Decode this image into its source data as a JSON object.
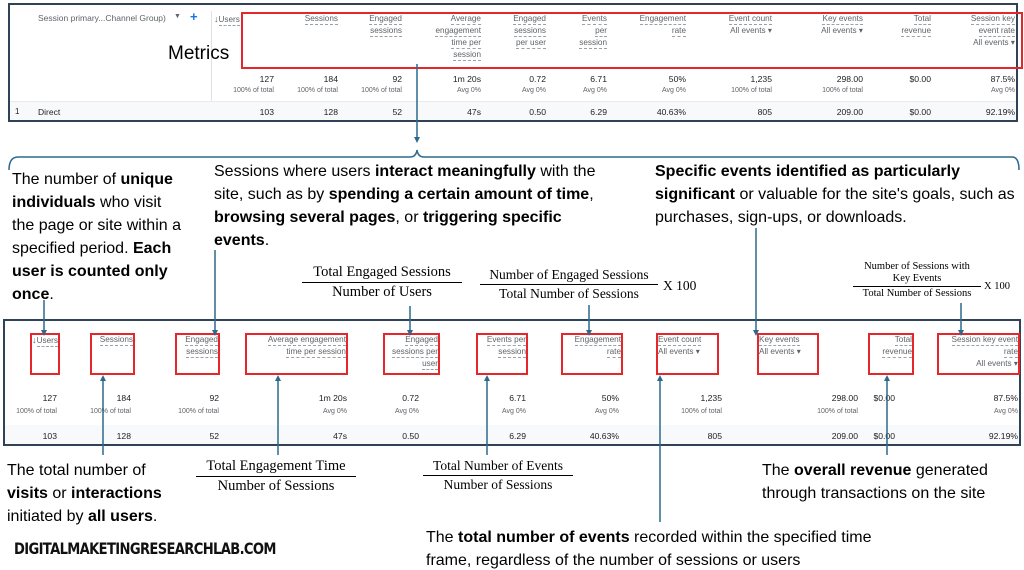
{
  "top_table": {
    "annotation_label": "Metrics",
    "dimension_header": "Session primary...Channel Group)",
    "dimension_caret_icon": "chevron-down-icon",
    "add_dimension_icon": "plus-icon",
    "sort_icon": "arrow-down-icon",
    "headers": [
      {
        "lines": [
          "Users"
        ]
      },
      {
        "lines": [
          "Sessions"
        ]
      },
      {
        "lines": [
          "Engaged",
          "sessions"
        ]
      },
      {
        "lines": [
          "Average",
          "engagement",
          "time per",
          "session"
        ]
      },
      {
        "lines": [
          "Engaged",
          "sessions",
          "per user"
        ]
      },
      {
        "lines": [
          "Events",
          "per",
          "session"
        ]
      },
      {
        "lines": [
          "Engagement",
          "rate"
        ]
      },
      {
        "lines": [
          "Event count"
        ],
        "dropdown": "All events"
      },
      {
        "lines": [
          "Key events"
        ],
        "dropdown": "All events"
      },
      {
        "lines": [
          "Total",
          "revenue"
        ]
      },
      {
        "lines": [
          "Session key",
          "event rate"
        ],
        "dropdown": "All events"
      }
    ],
    "totals": [
      "127",
      "184",
      "92",
      "1m 20s",
      "0.72",
      "6.71",
      "50%",
      "1,235",
      "298.00",
      "$0.00",
      "87.5%"
    ],
    "totals_sub": [
      "100% of total",
      "100% of total",
      "100% of total",
      "Avg 0%",
      "Avg 0%",
      "Avg 0%",
      "Avg 0%",
      "100% of total",
      "100% of total",
      "",
      "Avg 0%"
    ],
    "rows": [
      {
        "index": "1",
        "dimension": "Direct",
        "values": [
          "103",
          "128",
          "52",
          "47s",
          "0.50",
          "6.29",
          "40.63%",
          "805",
          "209.00",
          "$0.00",
          "92.19%"
        ]
      }
    ]
  },
  "bottom_table": {
    "sort_icon": "arrow-down-icon",
    "headers": [
      {
        "lines": [
          "Users"
        ]
      },
      {
        "lines": [
          "Sessions"
        ]
      },
      {
        "lines": [
          "Engaged",
          "sessions"
        ]
      },
      {
        "lines": [
          "Average engagement",
          "time per session"
        ]
      },
      {
        "lines": [
          "Engaged",
          "sessions per",
          "user"
        ]
      },
      {
        "lines": [
          "Events per",
          "session"
        ]
      },
      {
        "lines": [
          "Engagement",
          "rate"
        ]
      },
      {
        "lines": [
          "Event count"
        ],
        "dropdown": "All events"
      },
      {
        "lines": [
          "Key events"
        ],
        "dropdown": "All events"
      },
      {
        "lines": [
          "Total",
          "revenue"
        ]
      },
      {
        "lines": [
          "Session key event",
          "rate"
        ],
        "dropdown": "All events"
      }
    ],
    "totals": [
      "127",
      "184",
      "92",
      "1m 20s",
      "0.72",
      "6.71",
      "50%",
      "1,235",
      "298.00",
      "$0.00",
      "87.5%"
    ],
    "totals_sub": [
      "100% of total",
      "100% of total",
      "100% of total",
      "Avg 0%",
      "Avg 0%",
      "Avg 0%",
      "Avg 0%",
      "100% of total",
      "100% of total",
      "",
      "Avg 0%"
    ],
    "row_values": [
      "103",
      "128",
      "52",
      "47s",
      "0.50",
      "6.29",
      "40.63%",
      "805",
      "209.00",
      "$0.00",
      "92.19%"
    ]
  },
  "annotations": {
    "users": {
      "parts": [
        {
          "t": "The number of ",
          "b": false
        },
        {
          "t": "unique individuals",
          "b": true
        },
        {
          "t": " who visit the page or site within a specified period. ",
          "b": false
        },
        {
          "t": "Each user is counted only once",
          "b": true
        },
        {
          "t": ".",
          "b": false
        }
      ]
    },
    "engaged_sessions": {
      "parts": [
        {
          "t": "Sessions where users ",
          "b": false
        },
        {
          "t": "interact meaningfully",
          "b": true
        },
        {
          "t": " with the site, such as by ",
          "b": false
        },
        {
          "t": "spending a certain amount of time",
          "b": true
        },
        {
          "t": ", ",
          "b": false
        },
        {
          "t": "browsing several pages",
          "b": true
        },
        {
          "t": ", or ",
          "b": false
        },
        {
          "t": "triggering specific events",
          "b": true
        },
        {
          "t": ".",
          "b": false
        }
      ]
    },
    "key_events": {
      "parts": [
        {
          "t": "Specific events identified as particularly significant",
          "b": true
        },
        {
          "t": " or valuable for the site's goals, such as purchases, sign-ups, or downloads.",
          "b": false
        }
      ]
    },
    "sessions": {
      "parts": [
        {
          "t": "The total number of ",
          "b": false
        },
        {
          "t": "visits",
          "b": true
        },
        {
          "t": " or ",
          "b": false
        },
        {
          "t": "interactions",
          "b": true
        },
        {
          "t": " initiated by ",
          "b": false
        },
        {
          "t": "all users",
          "b": true
        },
        {
          "t": ".",
          "b": false
        }
      ]
    },
    "total_revenue": {
      "parts": [
        {
          "t": "The ",
          "b": false
        },
        {
          "t": "overall revenue",
          "b": true
        },
        {
          "t": " generated through transactions on the site",
          "b": false
        }
      ]
    },
    "event_count": {
      "parts": [
        {
          "t": "The ",
          "b": false
        },
        {
          "t": "total number of events",
          "b": true
        },
        {
          "t": " recorded within the specified time frame, regardless of the number of sessions or users",
          "b": false
        }
      ]
    }
  },
  "formulas": {
    "engaged_sessions_per_user": {
      "numerator": "Total Engaged Sessions",
      "denominator": "Number of Users",
      "suffix": ""
    },
    "engagement_rate": {
      "numerator": "Number of Engaged Sessions",
      "denominator": "Total Number of Sessions",
      "suffix": "X 100"
    },
    "session_key_event_rate": {
      "numerator": "Number of Sessions with Key Events",
      "denominator": "Total Number of Sessions",
      "suffix": "X 100"
    },
    "avg_engagement_time": {
      "numerator": "Total Engagement Time",
      "denominator": "Number of Sessions",
      "suffix": ""
    },
    "events_per_session": {
      "numerator": "Total Number of Events",
      "denominator": "Number of Sessions",
      "suffix": ""
    }
  },
  "brand": "DIGITALMAKETINGRESEARCHLAB.COM",
  "colors": {
    "highlight_box": "#e5262b",
    "connector": "#2b6a8c",
    "panel_border": "#2f4257",
    "link_blue": "#1a73e8"
  }
}
